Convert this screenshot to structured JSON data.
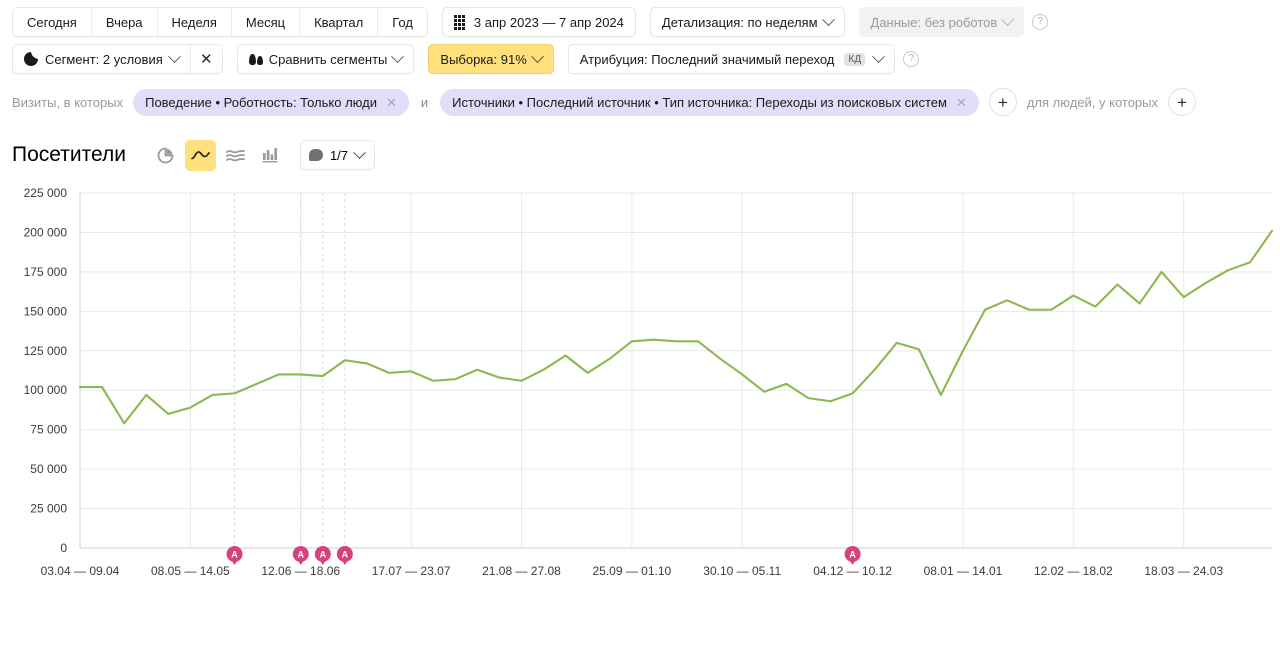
{
  "toolbar": {
    "periods": [
      "Сегодня",
      "Вчера",
      "Неделя",
      "Месяц",
      "Квартал",
      "Год"
    ],
    "date_range": "3 апр 2023 — 7 апр 2024",
    "date_range_icon": "calendar-grid-icon",
    "detalization": "Детализация: по неделям",
    "data_mode": "Данные: без роботов",
    "help_icon": "question-mark-icon"
  },
  "segments": {
    "segment_label": "Сегмент: 2 условия",
    "segment_icon": "pie-chart-icon",
    "segment_clear_icon": "close-icon",
    "compare_label": "Сравнить сегменты",
    "compare_icon": "two-drops-icon",
    "sampling_label": "Выборка: 91%",
    "sampling_color": "#ffe07d",
    "attribution_label": "Атрибуция: Последний значимый переход",
    "attribution_badge": "КД",
    "attribution_help_icon": "question-mark-icon"
  },
  "conditions": {
    "prefix": "Визиты, в которых",
    "chips": [
      "Поведение • Роботность: Только люди",
      "Источники • Последний источник • Тип источника: Переходы из поисковых систем"
    ],
    "conjunction": "и",
    "chip_remove_icon": "close-icon",
    "add_visit_condition_icon": "plus-icon",
    "people_label": "для людей, у которых",
    "add_people_condition_icon": "plus-icon",
    "chip_color": "#e3ddfa"
  },
  "chart_header": {
    "title": "Посетители",
    "view_buttons": [
      {
        "name": "pie-chart-view-icon",
        "active": false
      },
      {
        "name": "line-chart-view-icon",
        "active": true
      },
      {
        "name": "area-chart-view-icon",
        "active": false
      },
      {
        "name": "bar-chart-view-icon",
        "active": false
      }
    ],
    "comments_label": "1/7",
    "comments_icon": "speech-bubble-icon",
    "active_color": "#ffe07d"
  },
  "chart_data": {
    "type": "line",
    "title": "Посетители",
    "xlabel": "",
    "ylabel": "",
    "ylim": [
      0,
      225000
    ],
    "ytick_step": 25000,
    "ytick_labels": [
      "0",
      "25 000",
      "50 000",
      "75 000",
      "100 000",
      "125 000",
      "150 000",
      "175 000",
      "200 000",
      "225 000"
    ],
    "grid": true,
    "legend": "none",
    "line_color": "#8cb84f",
    "xtick_labels": [
      "03.04 — 09.04",
      "08.05 — 14.05",
      "12.06 — 18.06",
      "17.07 — 23.07",
      "21.08 — 27.08",
      "25.09 — 01.10",
      "30.10 — 05.11",
      "04.12 — 10.12",
      "08.01 — 14.01",
      "12.02 — 18.02",
      "18.03 — 24.03"
    ],
    "xtick_indices": [
      0,
      5,
      10,
      15,
      20,
      25,
      30,
      35,
      40,
      45,
      50
    ],
    "series": [
      {
        "name": "Посетители",
        "values": [
          102000,
          102000,
          79000,
          97000,
          85000,
          89000,
          97000,
          98000,
          104000,
          110000,
          110000,
          109000,
          119000,
          117000,
          111000,
          112000,
          106000,
          107000,
          113000,
          108000,
          106000,
          113000,
          122000,
          111000,
          120000,
          131000,
          132000,
          131000,
          131000,
          120000,
          110000,
          99000,
          104000,
          95000,
          93000,
          98000,
          113000,
          130000,
          126000,
          97000,
          125000,
          151000,
          157000,
          151000,
          151000,
          160000,
          153000,
          167000,
          155000,
          175000,
          159000,
          168000,
          176000,
          181000,
          201000
        ]
      }
    ],
    "annotations": [
      {
        "label": "A",
        "x_index": 7,
        "color": "#d6427e"
      },
      {
        "label": "A",
        "x_index": 10,
        "color": "#d6427e"
      },
      {
        "label": "A",
        "x_index": 11,
        "color": "#d6427e"
      },
      {
        "label": "A",
        "x_index": 12,
        "color": "#d6427e"
      },
      {
        "label": "A",
        "x_index": 35,
        "color": "#d6427e"
      }
    ]
  }
}
